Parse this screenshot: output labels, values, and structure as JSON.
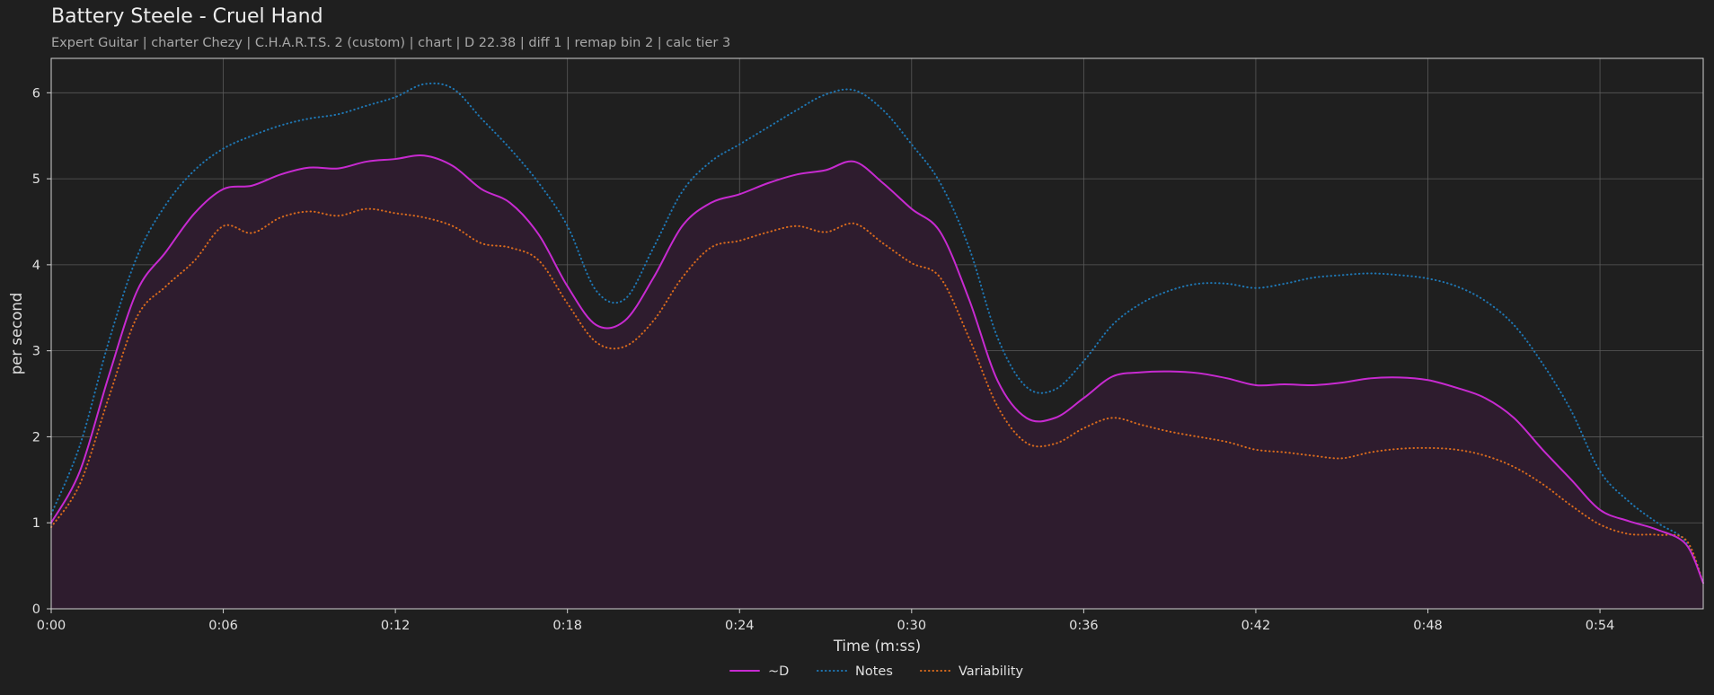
{
  "header": {
    "title": "Battery Steele - Cruel Hand",
    "subtitle": "Expert Guitar  |  charter Chezy  |  C.H.A.R.T.S. 2 (custom)  |  chart  |  D 22.38  |  diff 1  |  remap bin 2  |  calc tier 3"
  },
  "colors": {
    "background": "#1f1f1f",
    "grid": "#5a5a5a",
    "axes": "#d0d0d0",
    "fill": "#2e1c2e"
  },
  "chart_data": {
    "type": "line",
    "xlabel": "Time (m:ss)",
    "ylabel": "per second",
    "xlim": [
      0,
      57.6
    ],
    "ylim": [
      0,
      6.4
    ],
    "grid": true,
    "legend_placement": "bottom-center",
    "x_ticks": [
      0,
      6,
      12,
      18,
      24,
      30,
      36,
      42,
      48,
      54
    ],
    "x_tick_labels": [
      "0:00",
      "0:06",
      "0:12",
      "0:18",
      "0:24",
      "0:30",
      "0:36",
      "0:42",
      "0:48",
      "0:54"
    ],
    "y_ticks": [
      0,
      1,
      2,
      3,
      4,
      5,
      6
    ],
    "y_tick_labels": [
      "0",
      "1",
      "2",
      "3",
      "4",
      "5",
      "6"
    ],
    "series": [
      {
        "name": "~D",
        "color": "#c72ad0",
        "style": "solid",
        "filled": true,
        "x": [
          0,
          1,
          2,
          3,
          4,
          5,
          6,
          7,
          8,
          9,
          10,
          11,
          12,
          13,
          14,
          15,
          16,
          17,
          18,
          19,
          20,
          21,
          22,
          23,
          24,
          25,
          26,
          27,
          28,
          29,
          30,
          31,
          32,
          33,
          34,
          35,
          36,
          37,
          38,
          39,
          40,
          41,
          42,
          43,
          44,
          45,
          46,
          47,
          48,
          49,
          50,
          51,
          52,
          53,
          54,
          55,
          56,
          57,
          57.6
        ],
        "y": [
          1.0,
          1.6,
          2.7,
          3.7,
          4.15,
          4.6,
          4.88,
          4.92,
          5.05,
          5.13,
          5.12,
          5.2,
          5.23,
          5.27,
          5.15,
          4.88,
          4.72,
          4.35,
          3.75,
          3.3,
          3.35,
          3.85,
          4.45,
          4.72,
          4.82,
          4.95,
          5.05,
          5.1,
          5.2,
          4.95,
          4.65,
          4.38,
          3.6,
          2.65,
          2.22,
          2.22,
          2.45,
          2.7,
          2.75,
          2.76,
          2.74,
          2.68,
          2.6,
          2.61,
          2.6,
          2.63,
          2.68,
          2.69,
          2.66,
          2.57,
          2.45,
          2.22,
          1.85,
          1.5,
          1.15,
          1.02,
          0.92,
          0.75,
          0.3
        ]
      },
      {
        "name": "Notes",
        "color": "#1f77b4",
        "style": "dotted",
        "filled": false,
        "x": [
          0,
          1,
          2,
          3,
          4,
          5,
          6,
          7,
          8,
          9,
          10,
          11,
          12,
          13,
          14,
          15,
          16,
          17,
          18,
          19,
          20,
          21,
          22,
          23,
          24,
          25,
          26,
          27,
          28,
          29,
          30,
          31,
          32,
          33,
          34,
          35,
          36,
          37,
          38,
          39,
          40,
          41,
          42,
          43,
          44,
          45,
          46,
          47,
          48,
          49,
          50,
          51,
          52,
          53,
          54,
          55,
          56,
          57,
          57.6
        ],
        "y": [
          1.1,
          1.9,
          3.1,
          4.1,
          4.7,
          5.1,
          5.35,
          5.5,
          5.62,
          5.7,
          5.75,
          5.85,
          5.95,
          6.1,
          6.05,
          5.7,
          5.35,
          4.95,
          4.45,
          3.7,
          3.6,
          4.2,
          4.85,
          5.2,
          5.4,
          5.6,
          5.8,
          5.98,
          6.03,
          5.8,
          5.4,
          4.95,
          4.2,
          3.15,
          2.58,
          2.55,
          2.88,
          3.3,
          3.55,
          3.7,
          3.78,
          3.78,
          3.73,
          3.78,
          3.85,
          3.88,
          3.9,
          3.88,
          3.84,
          3.75,
          3.58,
          3.3,
          2.85,
          2.3,
          1.6,
          1.25,
          1.0,
          0.78,
          0.3
        ]
      },
      {
        "name": "Variability",
        "color": "#d86a1d",
        "style": "dotted",
        "filled": false,
        "x": [
          0,
          1,
          2,
          3,
          4,
          5,
          6,
          7,
          8,
          9,
          10,
          11,
          12,
          13,
          14,
          15,
          16,
          17,
          18,
          19,
          20,
          21,
          22,
          23,
          24,
          25,
          26,
          27,
          28,
          29,
          30,
          31,
          32,
          33,
          34,
          35,
          36,
          37,
          38,
          39,
          40,
          41,
          42,
          43,
          44,
          45,
          46,
          47,
          48,
          49,
          50,
          51,
          52,
          53,
          54,
          55,
          56,
          57,
          57.6
        ],
        "y": [
          0.95,
          1.45,
          2.45,
          3.4,
          3.75,
          4.05,
          4.45,
          4.37,
          4.55,
          4.62,
          4.57,
          4.65,
          4.6,
          4.55,
          4.45,
          4.25,
          4.2,
          4.05,
          3.55,
          3.1,
          3.05,
          3.35,
          3.85,
          4.2,
          4.28,
          4.38,
          4.45,
          4.38,
          4.48,
          4.25,
          4.02,
          3.85,
          3.15,
          2.35,
          1.93,
          1.92,
          2.1,
          2.22,
          2.14,
          2.06,
          2.0,
          1.94,
          1.85,
          1.82,
          1.78,
          1.75,
          1.82,
          1.86,
          1.87,
          1.85,
          1.78,
          1.65,
          1.45,
          1.2,
          0.98,
          0.87,
          0.86,
          0.8,
          0.3
        ]
      }
    ]
  }
}
